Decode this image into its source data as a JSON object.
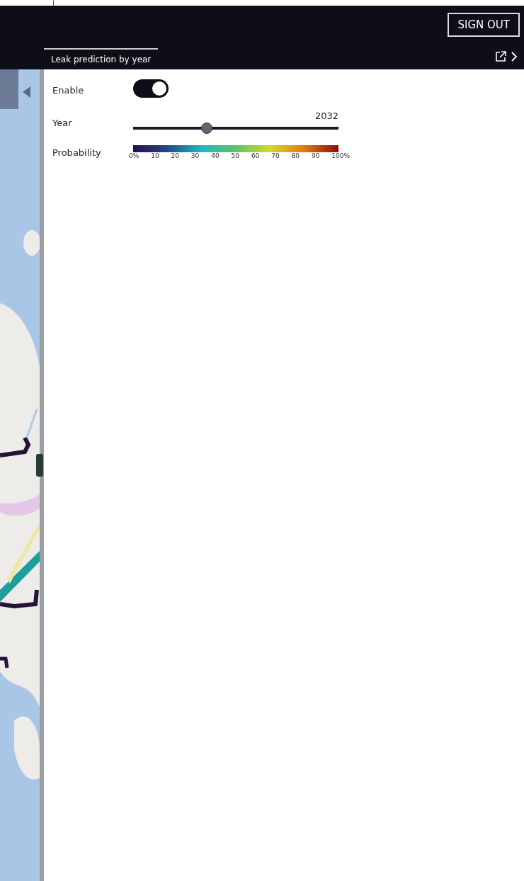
{
  "header": {
    "sign_out": "SIGN OUT"
  },
  "tabs": [
    {
      "label": "Leak prediction by year",
      "selected": true
    }
  ],
  "map": {
    "collapse_panel": {
      "expanded": true
    }
  },
  "settings": {
    "enable": {
      "label": "Enable",
      "on": true
    },
    "year": {
      "label": "Year",
      "reading": "2032",
      "level": 0.35
    },
    "probability": {
      "label": "Probability",
      "ticks": [
        "0%",
        "10",
        "20",
        "30",
        "40",
        "50",
        "60",
        "70",
        "80",
        "90",
        "100%"
      ]
    }
  }
}
